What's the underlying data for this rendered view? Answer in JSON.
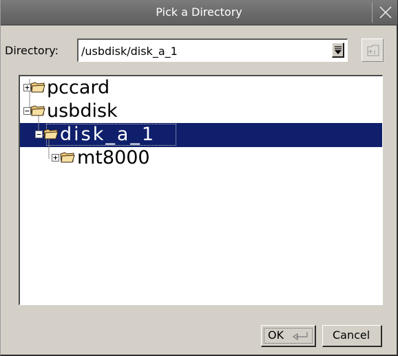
{
  "window": {
    "title": "Pick a Directory"
  },
  "directory": {
    "label": "Directory:",
    "value": "/usbdisk/disk_a_1"
  },
  "tree": {
    "nodes": [
      {
        "label": "pccard",
        "expanded": false,
        "selected": false
      },
      {
        "label": "usbdisk",
        "expanded": true,
        "selected": false
      },
      {
        "label": "disk_a_1",
        "expanded": true,
        "selected": true
      },
      {
        "label": "mt8000",
        "expanded": false,
        "selected": false
      }
    ]
  },
  "buttons": {
    "ok_label": "OK",
    "cancel_label": "Cancel"
  },
  "icons": {
    "close": "close-icon",
    "dropdown": "chevron-down-icon",
    "new_folder": "new-folder-icon",
    "folder": "folder-icon",
    "enter": "enter-key-icon"
  },
  "colors": {
    "title_bar": "#6a6a6a",
    "selection": "#0f1f6b",
    "dialog_bg": "#d4d0c8"
  }
}
